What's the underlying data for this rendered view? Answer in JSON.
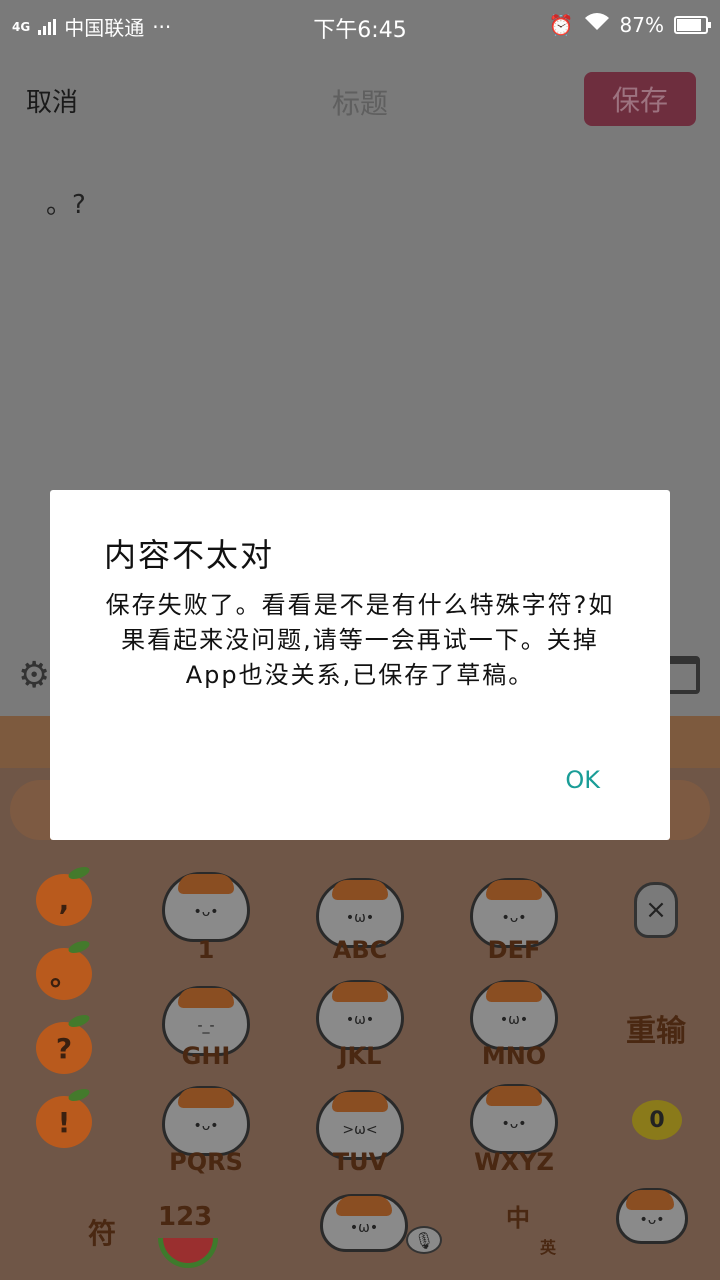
{
  "status_bar": {
    "network": "4G",
    "carrier": "中国联通",
    "more": "···",
    "time": "下午6:45",
    "battery_text": "87%",
    "battery_level": 0.87
  },
  "header": {
    "cancel_label": "取消",
    "title_placeholder": "标题",
    "save_label": "保存"
  },
  "editor": {
    "content": "。?"
  },
  "keyboard": {
    "left_column": [
      ",",
      "。",
      "?",
      "!"
    ],
    "keys": [
      "1",
      "ABC",
      "DEF",
      "GHI",
      "JKL",
      "MNO",
      "PQRS",
      "TUV",
      "WXYZ"
    ],
    "delete_icon": "×",
    "retype_label": "重输",
    "zero_label": "0",
    "symbol_label": "符",
    "num_label": "123",
    "lang_label": "中",
    "lang_sub": "英"
  },
  "dialog": {
    "title": "内容不太对",
    "message": "保存失败了。看看是不是有什么特殊字符?如果看起来没问题,请等一会再试一下。关掉App也没关系,已保存了草稿。",
    "ok_label": "OK"
  },
  "colors": {
    "accent": "#1a9d97",
    "save_button": "#6e2e3e"
  }
}
